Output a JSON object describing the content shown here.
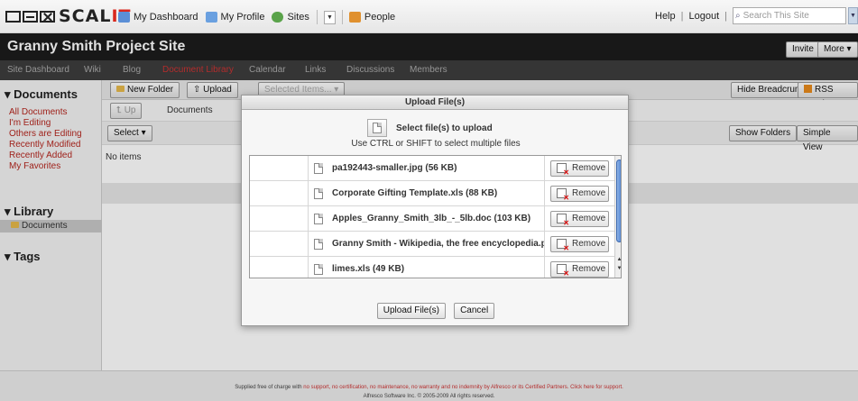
{
  "topbar": {
    "logo": {
      "text_main": "SCAL",
      "text_accent": "IT"
    },
    "nav": [
      {
        "label": "My Dashboard",
        "icon": "dashboard-icon",
        "color": "#5b8fd6"
      },
      {
        "label": "My Profile",
        "icon": "profile-icon",
        "color": "#6aa0e0"
      },
      {
        "label": "Sites",
        "icon": "sites-icon",
        "color": "#5aa34a"
      },
      {
        "label": "People",
        "icon": "people-icon",
        "color": "#e0902e"
      }
    ],
    "help": "Help",
    "logout": "Logout",
    "search_placeholder": "Search This Site"
  },
  "site": {
    "title": "Granny Smith Project Site",
    "invite": "Invite",
    "more": "More ▾"
  },
  "sitenav": [
    "Site Dashboard",
    "Wiki",
    "Blog",
    "Document Library",
    "Calendar",
    "Links",
    "Discussions",
    "Members"
  ],
  "left": {
    "documents_heading": "▾ Documents",
    "doc_links": [
      "All Documents",
      "I'm Editing",
      "Others are Editing",
      "Recently Modified",
      "Recently Added",
      "My Favorites"
    ],
    "library_heading": "▾ Library",
    "library_item": "Documents",
    "tags_heading": "▾ Tags"
  },
  "main": {
    "new_folder": "New Folder",
    "upload": "Upload",
    "selected_items": "Selected Items... ▾",
    "hide_breadcrumb": "Hide Breadcrumb",
    "rss_feed": "RSS Feed",
    "up": "Up",
    "breadcrumb": "Documents",
    "select": "Select ▾",
    "show_folders": "Show Folders",
    "simple_view": "Simple View",
    "no_items": "No items"
  },
  "dialog": {
    "title": "Upload File(s)",
    "select_label": "Select file(s) to upload",
    "hint": "Use CTRL or SHIFT to select multiple files",
    "files": [
      "pa192443-smaller.jpg (56 KB)",
      "Corporate Gifting Template.xls (88 KB)",
      "Apples_Granny_Smith_3lb_-_5lb.doc (103 KB)",
      "Granny Smith - Wikipedia, the free encyclopedia.pc",
      "limes.xls (49 KB)"
    ],
    "remove": "Remove",
    "upload_btn": "Upload File(s)",
    "cancel_btn": "Cancel"
  },
  "footer": {
    "line1_a": "Supplied free of charge with",
    "line1_b": "no support, no certification, no maintenance, no warranty and no indemnity by Alfresco or its Certified Partners. Click here for support.",
    "line2": "Alfresco Software Inc. © 2005-2009 All rights reserved."
  }
}
